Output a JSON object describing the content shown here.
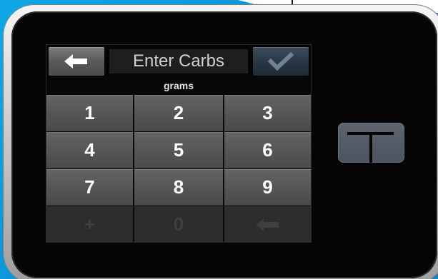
{
  "header": {
    "title": "Enter Carbs",
    "back_icon": "back-arrow-icon",
    "confirm_icon": "checkmark-icon"
  },
  "unit_label": "grams",
  "keypad": {
    "keys": [
      "1",
      "2",
      "3",
      "4",
      "5",
      "6",
      "7",
      "8",
      "9",
      "+",
      "0",
      "backspace"
    ],
    "disabled": [
      "+",
      "0",
      "backspace"
    ]
  },
  "device": {
    "logo": "t-logo",
    "colors": {
      "background_blue": "#0a8fd3",
      "screen_black": "#050505",
      "key_gray": "#565656",
      "confirm_blue": "#283644",
      "logo_button": "#4c525e"
    }
  }
}
